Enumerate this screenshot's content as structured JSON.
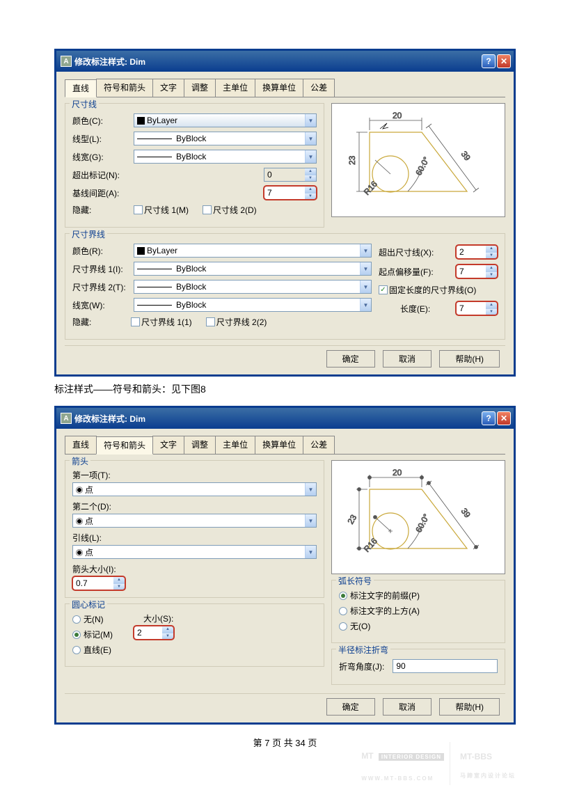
{
  "dialog1": {
    "title": "修改标注样式: Dim",
    "tabs": [
      "直线",
      "符号和箭头",
      "文字",
      "调整",
      "主单位",
      "换算单位",
      "公差"
    ],
    "active_tab": 0,
    "dimline_legend": "尺寸线",
    "color_lbl": "颜色(C):",
    "color_val": "ByLayer",
    "linetype_lbl": "线型(L):",
    "linetype_val": "ByBlock",
    "lineweight_lbl": "线宽(G):",
    "lineweight_val": "ByBlock",
    "extend_lbl": "超出标记(N):",
    "extend_val": "0",
    "baseline_lbl": "基线间距(A):",
    "baseline_val": "7",
    "hide_lbl": "隐藏:",
    "hide1": "尺寸线 1(M)",
    "hide2": "尺寸线 2(D)",
    "extline_legend": "尺寸界线",
    "ecolor_lbl": "颜色(R):",
    "ecolor_val": "ByLayer",
    "ext1_lbl": "尺寸界线 1(I):",
    "ext1_val": "ByBlock",
    "ext2_lbl": "尺寸界线 2(T):",
    "ext2_val": "ByBlock",
    "elw_lbl": "线宽(W):",
    "elw_val": "ByBlock",
    "ehide_lbl": "隐藏:",
    "ehide1": "尺寸界线 1(1)",
    "ehide2": "尺寸界线 2(2)",
    "beyond_lbl": "超出尺寸线(X):",
    "beyond_val": "2",
    "offset_lbl": "起点偏移量(F):",
    "offset_val": "7",
    "fixed_lbl": "固定长度的尺寸界线(O)",
    "length_lbl": "长度(E):",
    "length_val": "7",
    "ok": "确定",
    "cancel": "取消",
    "help": "帮助(H)"
  },
  "caption1": "标注样式——符号和箭头：见下图8",
  "dialog2": {
    "title": "修改标注样式: Dim",
    "tabs": [
      "直线",
      "符号和箭头",
      "文字",
      "调整",
      "主单位",
      "换算单位",
      "公差"
    ],
    "active_tab": 1,
    "arrow_legend": "箭头",
    "first_lbl": "第一项(T):",
    "first_val": "点",
    "second_lbl": "第二个(D):",
    "second_val": "点",
    "leader_lbl": "引线(L):",
    "leader_val": "点",
    "size_lbl": "箭头大小(I):",
    "size_val": "0.7",
    "center_legend": "圆心标记",
    "none_lbl": "无(N)",
    "mark_lbl": "标记(M)",
    "line_lbl": "直线(E)",
    "csize_lbl": "大小(S):",
    "csize_val": "2",
    "arc_legend": "弧长符号",
    "arc_before": "标注文字的前缀(P)",
    "arc_above": "标注文字的上方(A)",
    "arc_none": "无(O)",
    "jog_legend": "半径标注折弯",
    "jog_lbl": "折弯角度(J):",
    "jog_val": "90",
    "ok": "确定",
    "cancel": "取消",
    "help": "帮助(H)"
  },
  "page_footer": "第 7 页 共 34 页",
  "wm_mt": "MT",
  "wm_badge": "INTERIOR DESIGN",
  "wm_sub": "WWW.MT-BBS.COM",
  "wm_bbs": "MT-BBS",
  "wm_cn": "马蹄室内设计论坛"
}
